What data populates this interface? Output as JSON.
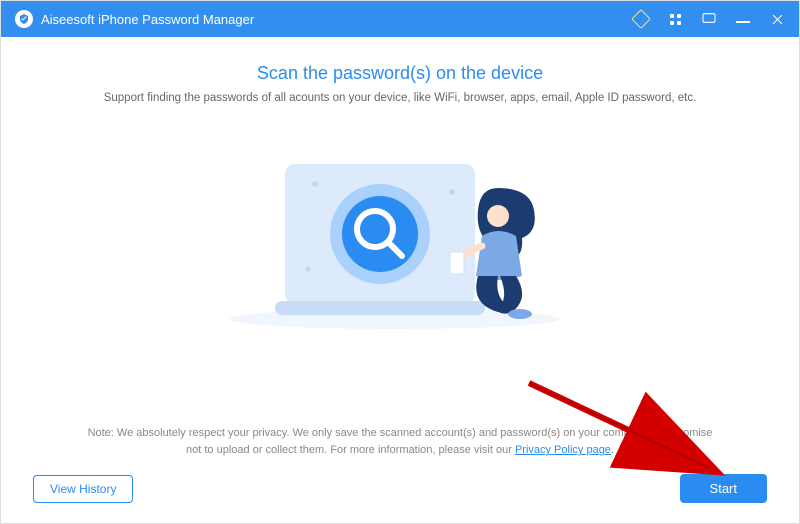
{
  "titlebar": {
    "app_name": "Aiseesoft iPhone Password Manager"
  },
  "main": {
    "heading": "Scan the password(s) on the device",
    "subheading": "Support finding the passwords of all acounts on your device, like  WiFi, browser, apps, email, Apple ID password, etc.",
    "note_prefix": "Note: We absolutely respect your privacy. We only save the scanned account(s) and password(s) on your computer and promise not to upload or collect them. For more information, please visit our ",
    "privacy_link_label": "Privacy Policy page",
    "note_suffix": "."
  },
  "footer": {
    "view_history_label": "View History",
    "start_label": "Start"
  }
}
